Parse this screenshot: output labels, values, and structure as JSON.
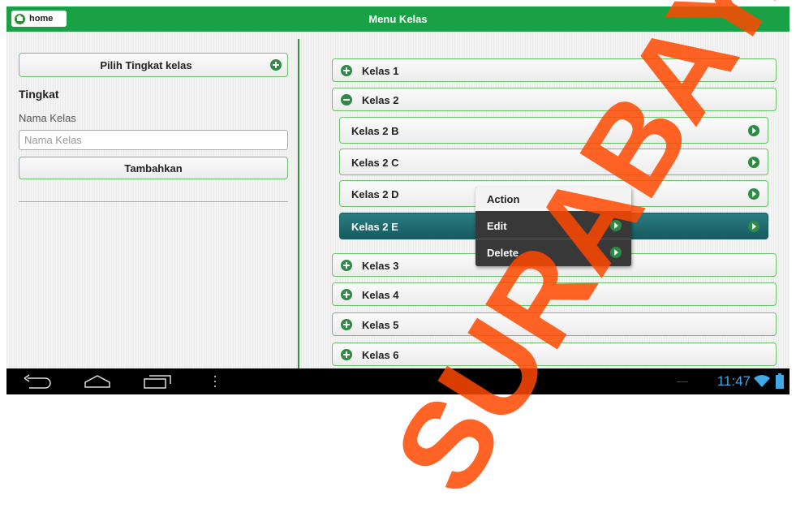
{
  "topbar": {
    "home_label": "home",
    "title": "Menu Kelas",
    "color": "#1aa146"
  },
  "left": {
    "pilih_label": "Pilih Tingkat kelas",
    "heading": "Tingkat",
    "nama_label": "Nama Kelas",
    "nama_placeholder": "Nama Kelas",
    "nama_value": "",
    "tambah_label": "Tambahkan"
  },
  "list": {
    "kelas1": "Kelas 1",
    "kelas2": "Kelas 2",
    "kelas2b": "Kelas 2 B",
    "kelas2c": "Kelas 2 C",
    "kelas2d": "Kelas 2 D",
    "kelas2e": "Kelas 2 E",
    "kelas3": "Kelas 3",
    "kelas4": "Kelas 4",
    "kelas5": "Kelas 5",
    "kelas6": "Kelas 6"
  },
  "context_menu": {
    "title": "Action",
    "edit": "Edit",
    "delete": "Delete"
  },
  "statusbar": {
    "time": "11:47",
    "time_color": "#3fa8e6"
  },
  "watermark": {
    "text": "SURABAYA",
    "color": "#ff4800"
  }
}
